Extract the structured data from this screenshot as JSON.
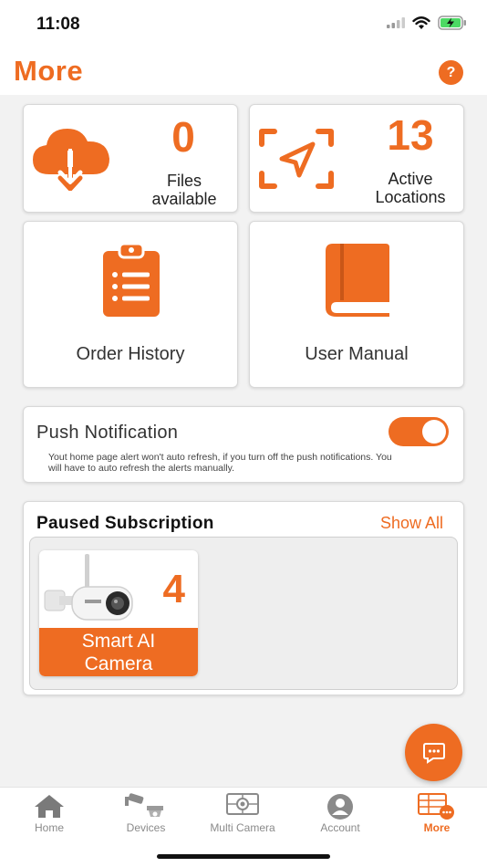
{
  "status_bar": {
    "time": "11:08",
    "icons": [
      "signal-icon",
      "wifi-icon",
      "battery-charging-icon"
    ]
  },
  "header": {
    "title": "More",
    "help_label": "?"
  },
  "stats": {
    "files": {
      "count": "0",
      "label_line1": "Files",
      "label_line2": "available",
      "icon": "cloud-download-icon"
    },
    "locations": {
      "count": "13",
      "label_line1": "Active",
      "label_line2": "Locations",
      "icon": "location-arrow-icon"
    }
  },
  "tiles": {
    "order_history": {
      "label": "Order History",
      "icon": "clipboard-list-icon"
    },
    "user_manual": {
      "label": "User Manual",
      "icon": "book-icon"
    }
  },
  "push_notification": {
    "title": "Push Notification",
    "description": "Yout home page alert won't auto refresh, if you turn off the push notifications. You will have to auto refresh the alerts manually.",
    "enabled": true
  },
  "paused_subscription": {
    "title": "Paused Subscription",
    "show_all_label": "Show All",
    "items": [
      {
        "label_line1": "Smart AI",
        "label_line2": "Camera",
        "count": "4"
      }
    ]
  },
  "tabbar": {
    "tabs": [
      {
        "label": "Home",
        "icon": "home-icon"
      },
      {
        "label": "Devices",
        "icon": "cctv-icon"
      },
      {
        "label": "Multi Camera",
        "icon": "multi-camera-icon"
      },
      {
        "label": "Account",
        "icon": "account-icon"
      },
      {
        "label": "More",
        "icon": "more-grid-icon"
      }
    ],
    "active": "More"
  },
  "colors": {
    "accent": "#ee6c22",
    "background": "#f2f2f2",
    "inactive": "#8a8a8a"
  }
}
